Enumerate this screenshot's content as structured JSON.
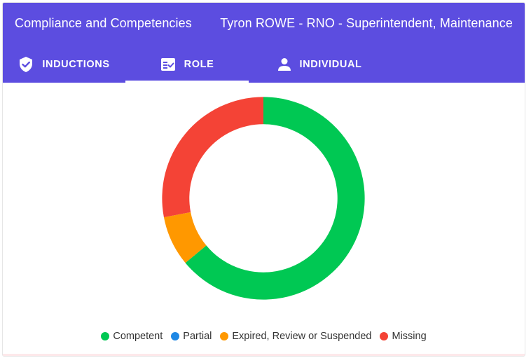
{
  "header": {
    "title": "Compliance and Competencies",
    "subtitle": "Tyron ROWE - RNO - Superintendent, Maintenance",
    "bg_color": "#5c4de0"
  },
  "tabs": [
    {
      "label": "INDUCTIONS",
      "icon": "verified-shield-icon",
      "active": false
    },
    {
      "label": "ROLE",
      "icon": "role-checklist-icon",
      "active": true
    },
    {
      "label": "INDIVIDUAL",
      "icon": "person-icon",
      "active": false
    }
  ],
  "chart_data": {
    "type": "pie",
    "donut": true,
    "categories": [
      "Competent",
      "Partial",
      "Expired, Review or Suspended",
      "Missing"
    ],
    "values": [
      64,
      0,
      8,
      28
    ],
    "colors": [
      "#00c853",
      "#1e88e5",
      "#ff9800",
      "#f44336"
    ],
    "legend_position": "bottom"
  },
  "legend": [
    {
      "label": "Competent",
      "color": "#00c853"
    },
    {
      "label": "Partial",
      "color": "#1e88e5"
    },
    {
      "label": "Expired, Review or Suspended",
      "color": "#ff9800"
    },
    {
      "label": "Missing",
      "color": "#f44336"
    }
  ]
}
